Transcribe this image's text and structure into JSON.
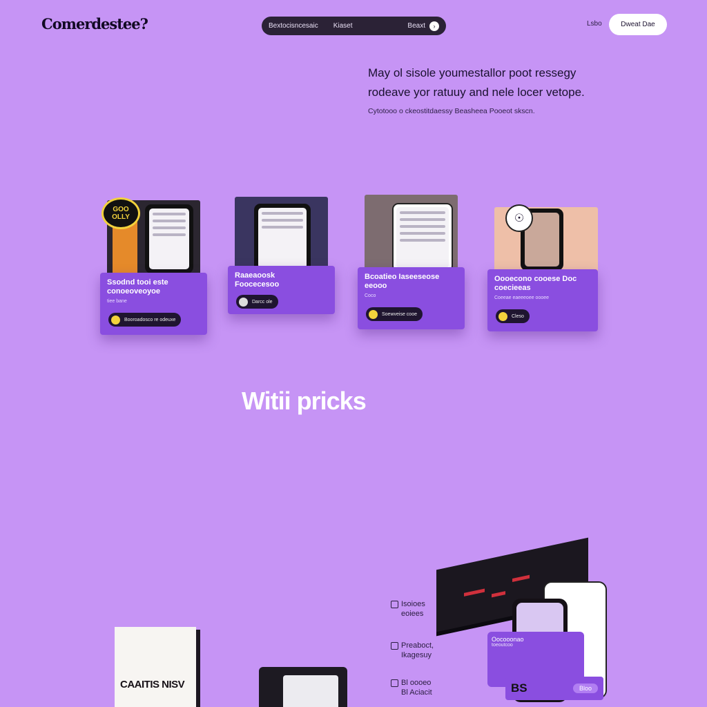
{
  "header": {
    "logo": "Comerdestee?",
    "nav": {
      "items": [
        "Bextocisncesaic",
        "Kiaset"
      ],
      "right_label": "Beaxt"
    },
    "login": "Lsbo",
    "cta": "Dweat Dae"
  },
  "hero": {
    "title": "May ol sisole youmestallor poot ressegy rodeave yor ratuuy and nele locer vetope.",
    "subtitle": "Cytotooo o ckeostitdaessy Beasheea Pooeot skscn."
  },
  "cards": [
    {
      "title": "Ssodnd tooi este conoeoveoyoe",
      "meta": "tiee bane",
      "button": "Booroadosco re odeuxe"
    },
    {
      "title": "Raaeaoosk Foocecesoo",
      "meta": "",
      "button": "Darcc ole"
    },
    {
      "title": "Bcoatieo Iaseeseose eeooo",
      "meta": "Coco",
      "button": "Soewveise cooe"
    },
    {
      "title": "Oooecono cooese Doc coecieeas",
      "meta": "Coeeae eaeeeoee oooee",
      "button": "Cleso"
    }
  ],
  "badge": "GOO OLLY",
  "section_title": "Witii pricks",
  "features": [
    {
      "line1": "Isoioes",
      "line2": "eoiees"
    },
    {
      "line1": "Preaboct,",
      "line2": "Ikagesuy"
    },
    {
      "line1": "Bl oooeo",
      "line2": "Bl Aciacit"
    }
  ],
  "book_title": "CAAITIS NISV",
  "product_card": {
    "title": "Oocooonao",
    "sub": "toeoutcoo",
    "code": "BS",
    "chip": "Bloo"
  },
  "colors": {
    "background": "#c694f5",
    "accent_purple": "#8a4ee0",
    "dark": "#2b2236",
    "coin": "#f2d23c"
  }
}
